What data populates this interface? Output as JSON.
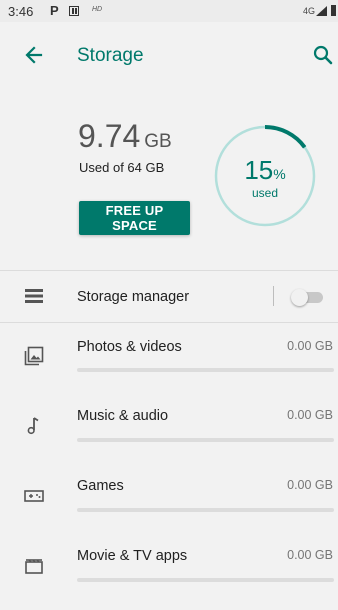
{
  "status_bar": {
    "time": "3:46",
    "p_icon": "P",
    "hd": "HD",
    "network": "4G"
  },
  "app_bar": {
    "title": "Storage"
  },
  "summary": {
    "used_amount": "9.74",
    "used_unit": "GB",
    "used_of": "Used of 64 GB",
    "free_up_label": "FREE UP SPACE",
    "percent_value": "15",
    "percent_sign": "%",
    "percent_label": "used",
    "percent_fraction": 0.15
  },
  "storage_manager": {
    "label": "Storage manager",
    "enabled": false
  },
  "categories": [
    {
      "label": "Photos & videos",
      "size": "0.00 GB",
      "icon": "photos-icon",
      "fraction": 0
    },
    {
      "label": "Music & audio",
      "size": "0.00 GB",
      "icon": "music-note-icon",
      "fraction": 0
    },
    {
      "label": "Games",
      "size": "0.00 GB",
      "icon": "gamepad-icon",
      "fraction": 0
    },
    {
      "label": "Movie & TV apps",
      "size": "0.00 GB",
      "icon": "movie-icon",
      "fraction": 0
    }
  ],
  "colors": {
    "accent": "#00796b",
    "ring_track": "#b2dfdb",
    "background": "#f2f2f2"
  }
}
